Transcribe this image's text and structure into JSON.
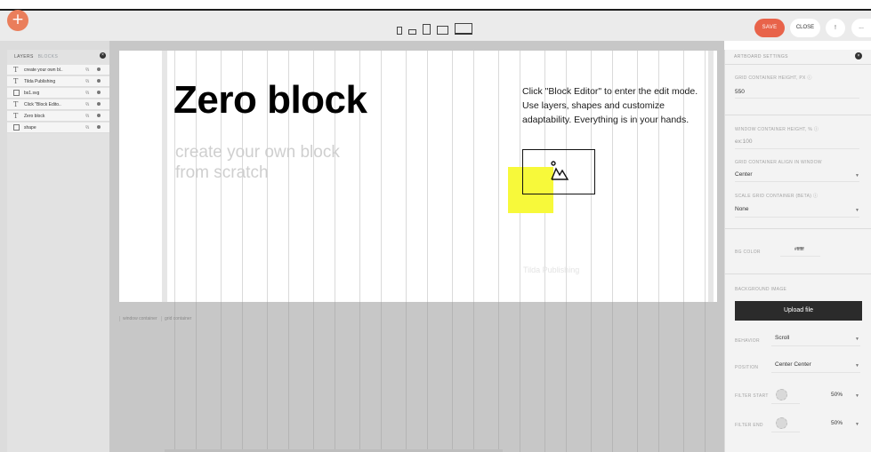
{
  "toolbar": {
    "add_icon": "plus-icon",
    "save_label": "SAVE",
    "close_label": "CLOSE",
    "extra_label": "!",
    "more_label": "..."
  },
  "layers_panel": {
    "tab_layers": "LAYERS",
    "tab_blocks": "BLOCKS",
    "items": [
      {
        "icon": "text-icon",
        "label": "create your own bl.."
      },
      {
        "icon": "text-icon",
        "label": "Tilda Publishing"
      },
      {
        "icon": "image-icon",
        "label": "bs1.svg"
      },
      {
        "icon": "text-icon",
        "label": "Click \"Block Edito.."
      },
      {
        "icon": "text-icon",
        "label": "Zero block"
      },
      {
        "icon": "shape-icon",
        "label": "shape"
      }
    ]
  },
  "artboard": {
    "heading": "Zero block",
    "subtitle": "create your own block from scratch",
    "description": "Click \"Block Editor\" to enter the edit mode. Use layers, shapes and customize adaptability. Everything is in your hands.",
    "publisher": "Tilda Publishing",
    "accent_color": "#f7f93a"
  },
  "container_labels": {
    "window": "window container",
    "grid": "grid container"
  },
  "settings": {
    "header": "ARTBOARD SETTINGS",
    "grid_height_label": "GRID CONTAINER HEIGHT, PX",
    "grid_height_value": "550",
    "window_height_label": "WINDOW CONTAINER HEIGHT, %",
    "window_height_placeholder": "ex:100",
    "grid_align_label": "GRID CONTAINER ALIGN IN WINDOW",
    "grid_align_value": "Center",
    "scale_grid_label": "SCALE GRID CONTAINER (BETA)",
    "scale_grid_value": "None",
    "bg_color_label": "BG COLOR",
    "bg_color_value": "#ffffff",
    "bg_image_label": "BACKGROUND IMAGE",
    "upload_label": "Upload file",
    "behavior_label": "BEHAVIOR",
    "behavior_value": "Scroll",
    "position_label": "POSITION",
    "position_value": "Center Center",
    "filter_start_label": "FILTER START",
    "filter_start_value": "50%",
    "filter_end_label": "FILTER END",
    "filter_end_value": "50%"
  }
}
